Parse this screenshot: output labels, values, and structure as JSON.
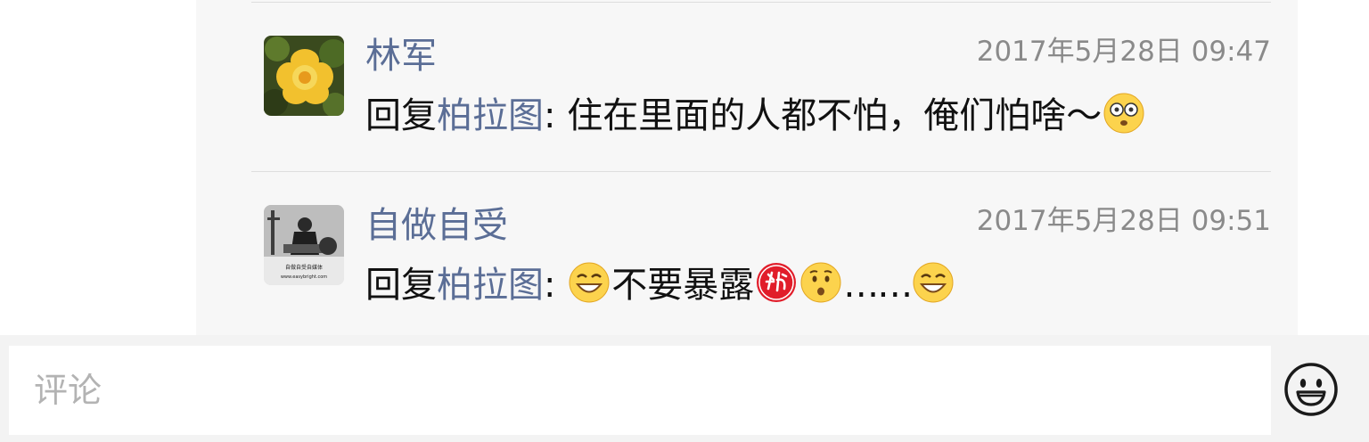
{
  "colors": {
    "link": "#5b6e96",
    "panel_bg": "#f7f7f7",
    "input_bar_bg": "#f3f3f3",
    "timestamp": "#8a8a8a"
  },
  "comments": [
    {
      "avatar_icon": "yellow-flower-avatar",
      "author": "林军",
      "time": "2017年5月28日 09:47",
      "reply_prefix": "回复",
      "reply_to": "柏拉图",
      "separator": ": ",
      "text": "住在里面的人都不怕，俺们怕啥～",
      "emoji_end": "flushed-face-emoji"
    },
    {
      "avatar_icon": "bw-photo-avatar",
      "author": "自做自受",
      "avatar_caption": "自做自受自媒体",
      "avatar_url_text": "www.easybright.com",
      "time": "2017年5月28日 09:51",
      "reply_prefix": "回复",
      "reply_to": "柏拉图",
      "separator": ": ",
      "text_part1": "不要暴露",
      "emojis": [
        "grinning-face-emoji",
        "secret-emoji",
        "hushed-face-emoji",
        "grinning-face-emoji"
      ],
      "ellipsis": "……"
    }
  ],
  "composer": {
    "placeholder": "评论",
    "emoji_button_icon": "smiley-face-icon"
  }
}
